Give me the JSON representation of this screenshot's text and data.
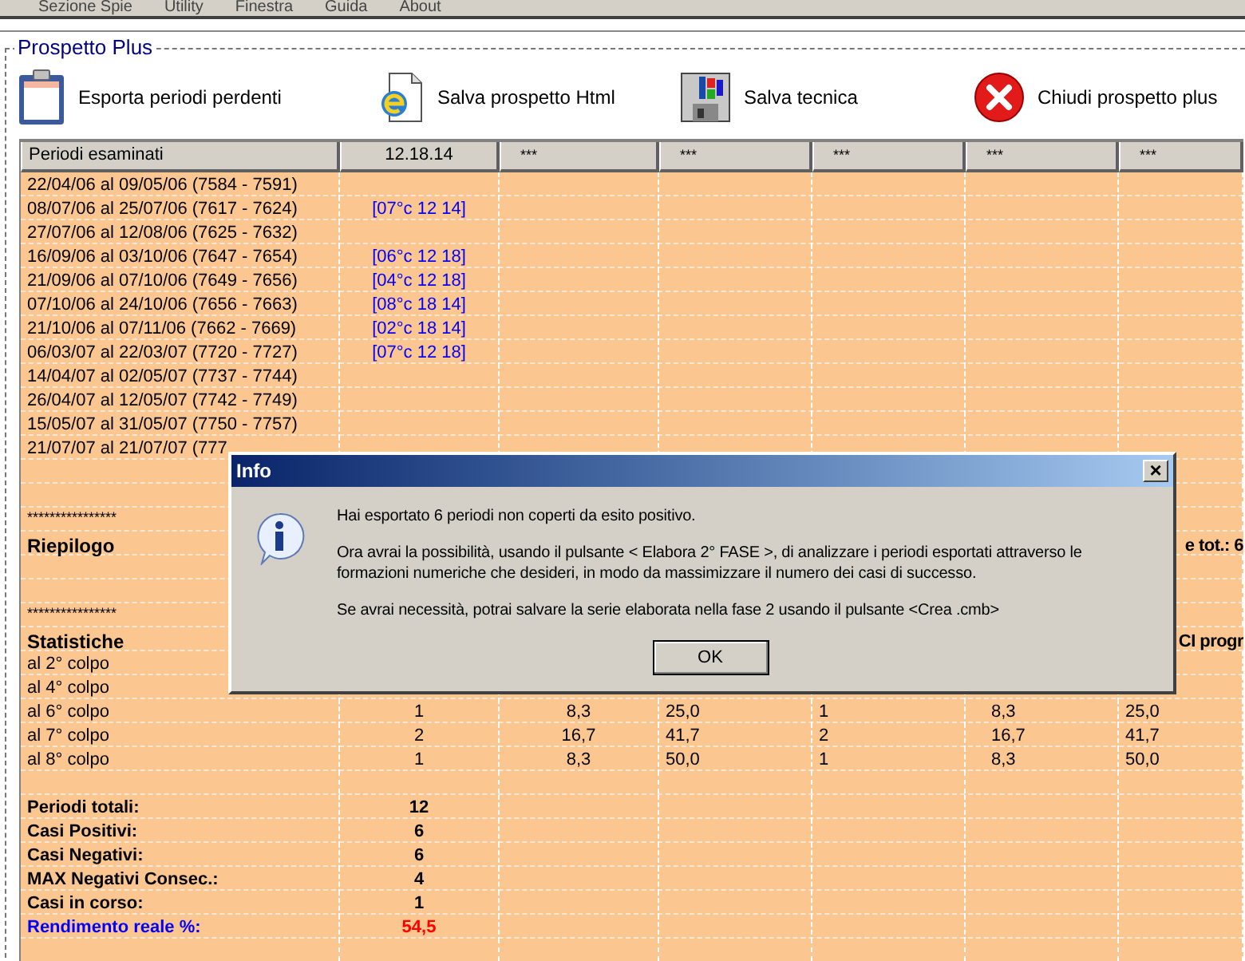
{
  "menu": [
    "Sezione Spie",
    "Utility",
    "Finestra",
    "Guida",
    "About"
  ],
  "group": {
    "title": "Prospetto Plus"
  },
  "toolbar": [
    {
      "kind": "clipboard",
      "label": "Esporta periodi perdenti"
    },
    {
      "kind": "html",
      "label": "Salva prospetto Html"
    },
    {
      "kind": "floppy",
      "label": "Salva tecnica"
    },
    {
      "kind": "close",
      "label": "Chiudi prospetto plus"
    }
  ],
  "table": {
    "columns": [
      "Periodi esaminati",
      "12.18.14",
      "***",
      "***",
      "***",
      "***",
      "***"
    ],
    "rows": [
      {
        "kind": "period",
        "label": "22/04/06 al 09/05/06  (7584 - 7591)"
      },
      {
        "kind": "period",
        "label": "08/07/06 al 25/07/06  (7617 - 7624)",
        "code": "[07°c 12 14]"
      },
      {
        "kind": "period",
        "label": "27/07/06 al 12/08/06  (7625 - 7632)"
      },
      {
        "kind": "period",
        "label": "16/09/06 al 03/10/06  (7647 - 7654)",
        "code": "[06°c 12 18]"
      },
      {
        "kind": "period",
        "label": "21/09/06 al 07/10/06  (7649 - 7656)",
        "code": "[04°c 12 18]"
      },
      {
        "kind": "period",
        "label": "07/10/06 al 24/10/06  (7656 - 7663)",
        "code": "[08°c 18 14]"
      },
      {
        "kind": "period",
        "label": "21/10/06 al 07/11/06  (7662 - 7669)",
        "code": "[02°c 18 14]"
      },
      {
        "kind": "period",
        "label": "06/03/07 al 22/03/07  (7720 - 7727)",
        "code": "[07°c 12 18]"
      },
      {
        "kind": "period",
        "label": "14/04/07 al 02/05/07  (7737 - 7744)"
      },
      {
        "kind": "period",
        "label": "26/04/07 al 12/05/07  (7742 - 7749)"
      },
      {
        "kind": "period",
        "label": "15/05/07 al 31/05/07  (7750 - 7757)"
      },
      {
        "kind": "period",
        "label": "21/07/07 al 21/07/07  (777"
      },
      {
        "kind": "blank"
      },
      {
        "kind": "blank"
      },
      {
        "kind": "stars",
        "label": "****************"
      },
      {
        "kind": "section",
        "label": "Riepilogo",
        "right": "e tot.: 6"
      },
      {
        "kind": "blank"
      },
      {
        "kind": "blank"
      },
      {
        "kind": "stars",
        "label": "****************"
      },
      {
        "kind": "section",
        "label": "Statistiche",
        "right": "CI progr"
      },
      {
        "kind": "stat",
        "label": "al 2° colpo"
      },
      {
        "kind": "stat",
        "label": "al 4° colpo"
      },
      {
        "kind": "stat",
        "label": "al 6° colpo",
        "values": [
          "1",
          "8,3",
          "25,0",
          "1",
          "8,3",
          "25,0"
        ]
      },
      {
        "kind": "stat",
        "label": "al 7° colpo",
        "values": [
          "2",
          "16,7",
          "41,7",
          "2",
          "16,7",
          "41,7"
        ]
      },
      {
        "kind": "stat",
        "label": "al 8° colpo",
        "values": [
          "1",
          "8,3",
          "50,0",
          "1",
          "8,3",
          "50,0"
        ]
      },
      {
        "kind": "blank"
      },
      {
        "kind": "summary",
        "label": "Periodi totali:",
        "value": "12"
      },
      {
        "kind": "summary",
        "label": "Casi Positivi:",
        "value": "6"
      },
      {
        "kind": "summary",
        "label": "Casi Negativi:",
        "value": "6"
      },
      {
        "kind": "summary",
        "label": "MAX Negativi Consec.:",
        "value": "4"
      },
      {
        "kind": "summary",
        "label": "Casi in corso:",
        "value": "1"
      },
      {
        "kind": "yield",
        "label": "Rendimento reale %:",
        "value": "54,5"
      },
      {
        "kind": "blank"
      }
    ]
  },
  "dialog": {
    "title": "Info",
    "close": "×",
    "paragraphs": [
      "Hai esportato 6 periodi non coperti da esito positivo.",
      "Ora avrai la possibilità, usando il pulsante < Elabora 2° FASE >, di analizzare i periodi esportati attraverso le formazioni numeriche che desideri, in modo da massimizzare il numero dei casi di successo.",
      "Se avrai necessità, potrai salvare la serie elaborata nella fase 2 usando il pulsante <Crea .cmb>"
    ],
    "button": "OK"
  }
}
